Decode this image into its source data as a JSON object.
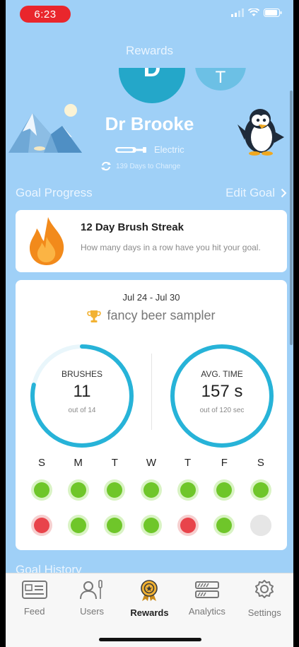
{
  "status": {
    "time": "6:23"
  },
  "nav": {
    "title": "Rewards"
  },
  "avatars": {
    "main_initial": "D",
    "second_initial": "T"
  },
  "profile": {
    "name": "Dr Brooke",
    "brush_type": "Electric",
    "change_text": "139 Days to Change"
  },
  "goal_progress": {
    "title": "Goal Progress",
    "edit_label": "Edit Goal"
  },
  "streak": {
    "title": "12 Day Brush Streak",
    "description": "How many days in a row have you hit your goal."
  },
  "week": {
    "range": "Jul 24 - Jul 30",
    "reward": "fancy beer sampler",
    "brushes": {
      "label": "BRUSHES",
      "value": "11",
      "sub": "out of 14",
      "progress": 0.786
    },
    "avg_time": {
      "label": "AVG. TIME",
      "value": "157 s",
      "sub": "out of 120 sec",
      "progress": 1.0
    },
    "days": [
      "S",
      "M",
      "T",
      "W",
      "T",
      "F",
      "S"
    ],
    "morning": [
      "green",
      "green",
      "green",
      "green",
      "green",
      "green",
      "green"
    ],
    "evening": [
      "red",
      "green",
      "green",
      "green",
      "red",
      "green",
      "gray"
    ]
  },
  "history": {
    "title": "Goal History"
  },
  "tabs": [
    {
      "label": "Feed",
      "icon": "feed-icon"
    },
    {
      "label": "Users",
      "icon": "users-icon"
    },
    {
      "label": "Rewards",
      "icon": "rewards-icon",
      "active": true
    },
    {
      "label": "Analytics",
      "icon": "analytics-icon"
    },
    {
      "label": "Settings",
      "icon": "settings-icon"
    }
  ],
  "colors": {
    "background": "#9fd0f7",
    "ring": "#27b3d8",
    "good": "#6fc62a",
    "bad": "#e8444b"
  }
}
